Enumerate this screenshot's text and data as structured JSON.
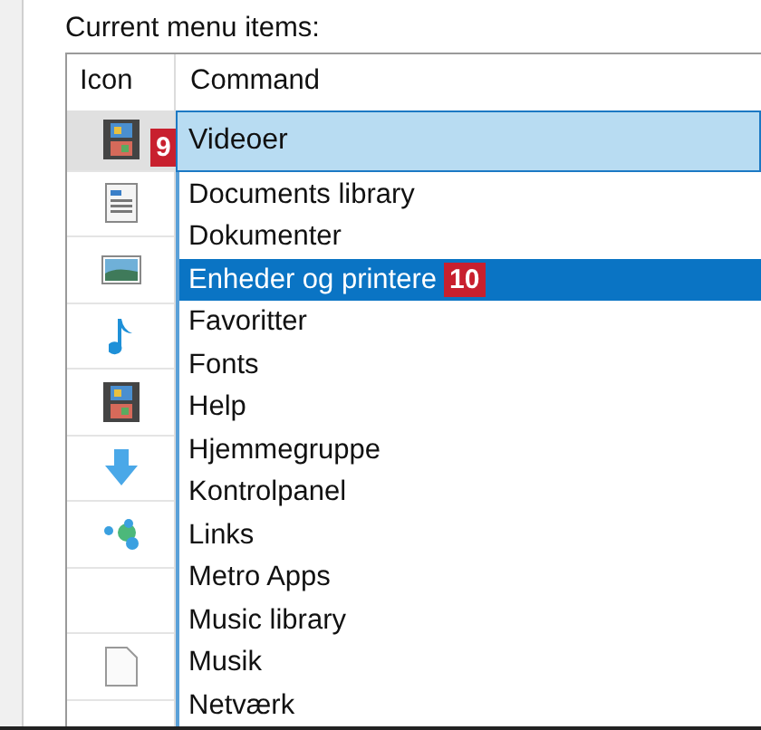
{
  "section_label": "Current menu items:",
  "table": {
    "columns": [
      "Icon",
      "Command"
    ],
    "icon_rows": [
      {
        "kind": "film"
      },
      {
        "kind": "document"
      },
      {
        "kind": "picture"
      },
      {
        "kind": "music"
      },
      {
        "kind": "film"
      },
      {
        "kind": "arrow"
      },
      {
        "kind": "links"
      },
      {
        "kind": "none"
      },
      {
        "kind": "page"
      }
    ],
    "command_field": {
      "value": "Videoer",
      "badge": "9"
    },
    "dropdown_items": [
      {
        "label": "Documents library",
        "selected": false
      },
      {
        "label": "Dokumenter",
        "selected": false
      },
      {
        "label": "Enheder og printere",
        "selected": true,
        "badge": "10"
      },
      {
        "label": "Favoritter",
        "selected": false
      },
      {
        "label": "Fonts",
        "selected": false
      },
      {
        "label": "Help",
        "selected": false
      },
      {
        "label": "Hjemmegruppe",
        "selected": false
      },
      {
        "label": "Kontrolpanel",
        "selected": false
      },
      {
        "label": "Links",
        "selected": false
      },
      {
        "label": "Metro Apps",
        "selected": false
      },
      {
        "label": "Music library",
        "selected": false
      },
      {
        "label": "Musik",
        "selected": false
      },
      {
        "label": "Netværk",
        "selected": false
      }
    ]
  }
}
